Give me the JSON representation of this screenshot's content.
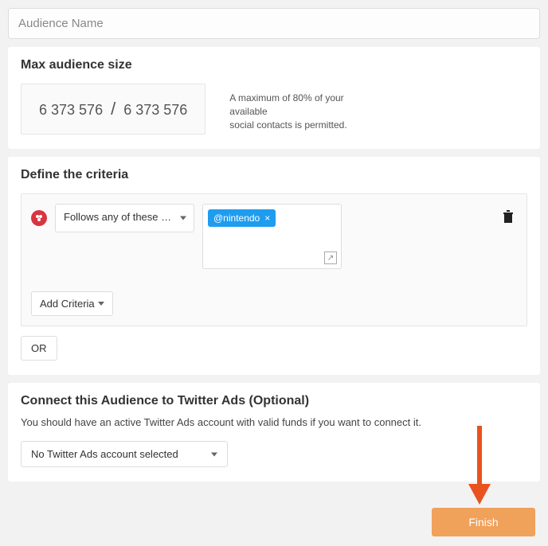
{
  "audienceName": {
    "placeholder": "Audience Name",
    "value": ""
  },
  "maxAudience": {
    "title": "Max audience size",
    "current": "6 373 576",
    "total": "6 373 576",
    "note_l1": "A maximum of 80% of your available",
    "note_l2": "social contacts is permitted."
  },
  "criteria": {
    "title": "Define the criteria",
    "rule_label": "Follows any of these accoun…",
    "tags": [
      {
        "label": "@nintendo"
      }
    ],
    "add_label": "Add Criteria",
    "or_label": "OR"
  },
  "twitterAds": {
    "title": "Connect this Audience to Twitter Ads (Optional)",
    "subtext": "You should have an active Twitter Ads account with valid funds if you want to connect it.",
    "selected": "No Twitter Ads account selected"
  },
  "finish_label": "Finish"
}
